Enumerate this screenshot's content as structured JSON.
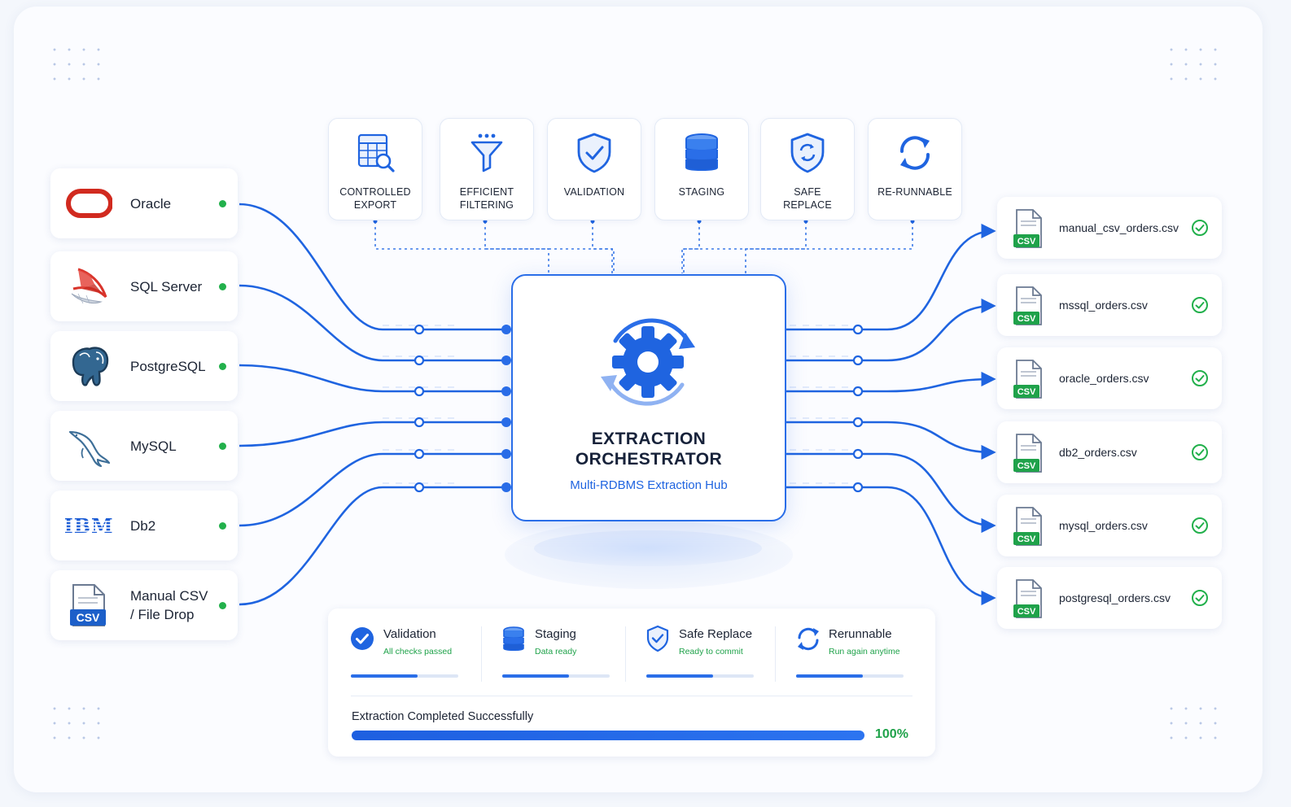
{
  "sources": [
    {
      "name": "Oracle",
      "logo": "oracle-logo"
    },
    {
      "name": "SQL Server",
      "logo": "sql-server-logo"
    },
    {
      "name": "PostgreSQL",
      "logo": "postgresql-elephant-logo"
    },
    {
      "name": "MySQL",
      "logo": "mysql-dolphin-logo"
    },
    {
      "name": "Db2",
      "logo": "ibm-logo"
    },
    {
      "name": "Manual CSV\n/ File Drop",
      "logo": "csv-file-icon",
      "badge": "CSV"
    }
  ],
  "features": [
    {
      "label": "CONTROLLED\nEXPORT",
      "icon": "table-search-icon"
    },
    {
      "label": "EFFICIENT\nFILTERING",
      "icon": "funnel-icon"
    },
    {
      "label": "VALIDATION",
      "icon": "shield-check-icon"
    },
    {
      "label": "STAGING",
      "icon": "database-icon"
    },
    {
      "label": "SAFE\nREPLACE",
      "icon": "shield-sync-icon"
    },
    {
      "label": "RE-RUNNABLE",
      "icon": "refresh-icon"
    }
  ],
  "hub": {
    "title": "EXTRACTION\nORCHESTRATOR",
    "subtitle": "Multi-RDBMS Extraction Hub",
    "icon": "gear-cycle-icon"
  },
  "outputs": [
    {
      "file": "manual_csv_orders.csv",
      "badge": "CSV"
    },
    {
      "file": "mssql_orders.csv",
      "badge": "CSV"
    },
    {
      "file": "oracle_orders.csv",
      "badge": "CSV"
    },
    {
      "file": "db2_orders.csv",
      "badge": "CSV"
    },
    {
      "file": "mysql_orders.csv",
      "badge": "CSV"
    },
    {
      "file": "postgresql_orders.csv",
      "badge": "CSV"
    }
  ],
  "stages": [
    {
      "title": "Validation",
      "subtitle": "All checks passed",
      "icon": "check-circle-icon",
      "progress": 0.62
    },
    {
      "title": "Staging",
      "subtitle": "Data ready",
      "icon": "database-icon",
      "progress": 0.62
    },
    {
      "title": "Safe Replace",
      "subtitle": "Ready to commit",
      "icon": "shield-check-icon",
      "progress": 0.62
    },
    {
      "title": "Rerunnable",
      "subtitle": "Run again anytime",
      "icon": "refresh-icon",
      "progress": 0.62
    }
  ],
  "completion": {
    "label": "Extraction Completed Successfully",
    "percent_label": "100%",
    "progress": 1.0
  },
  "colors": {
    "accent": "#2a6ee8",
    "success": "#22b04b",
    "oracle": "#d12a1f",
    "sqlserver": "#d9342b",
    "csv_badge_blue": "#1c5fc9",
    "csv_badge_green": "#1fa24a"
  }
}
